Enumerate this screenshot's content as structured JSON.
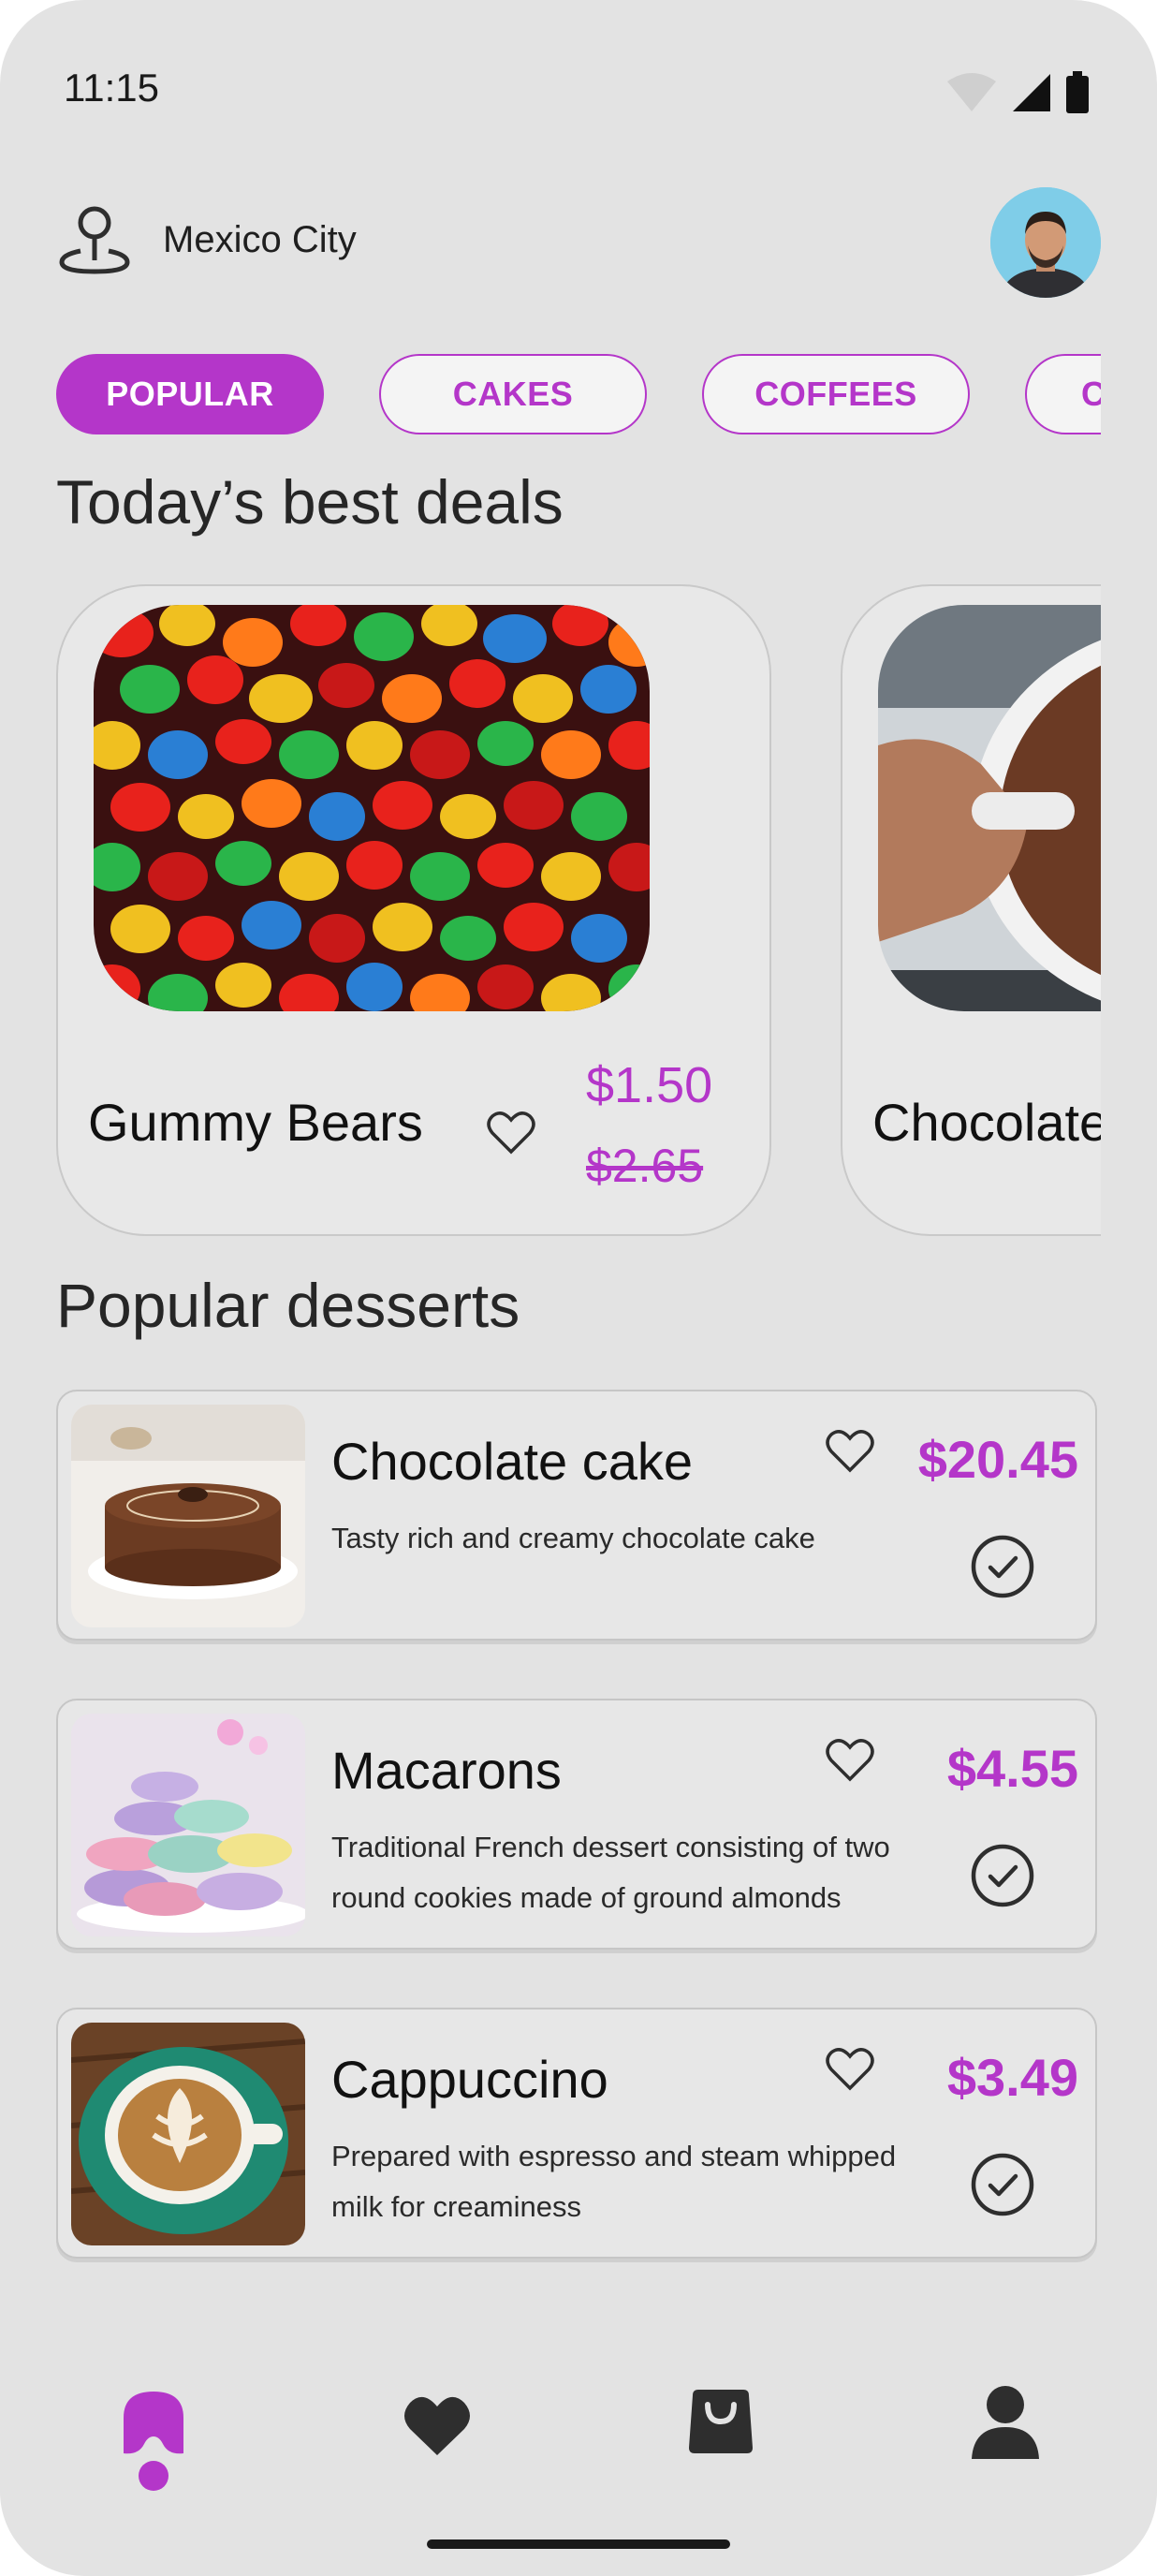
{
  "status": {
    "time": "11:15"
  },
  "location": {
    "label": "Mexico City"
  },
  "categories": [
    "POPULAR",
    "CAKES",
    "COFFEES",
    "C"
  ],
  "deals_section": {
    "title": "Today’s best deals"
  },
  "deals": [
    {
      "name": "Gummy Bears",
      "price": "$1.50",
      "old_price": "$2.65",
      "image": "gummy-bears-photo"
    },
    {
      "name": "Chocolate",
      "image": "hot-chocolate-photo"
    }
  ],
  "popular_section": {
    "title": "Popular desserts"
  },
  "popular": [
    {
      "name": "Chocolate cake",
      "desc": "Tasty rich and creamy chocolate cake",
      "price": "$20.45",
      "image": "chocolate-cake-photo"
    },
    {
      "name": "Macarons",
      "desc": "Traditional French dessert consisting of two round cookies made of ground almonds",
      "price": "$4.55",
      "image": "macarons-photo"
    },
    {
      "name": "Cappuccino",
      "desc": "Prepared with espresso and steam whipped milk for creaminess",
      "price": "$3.49",
      "image": "cappuccino-photo"
    }
  ],
  "nav": [
    "home-icon",
    "favorites-icon",
    "bag-icon",
    "profile-icon"
  ],
  "colors": {
    "accent": "#b436c9",
    "background": "#e3e3e3",
    "dark": "#2e2e2e"
  }
}
